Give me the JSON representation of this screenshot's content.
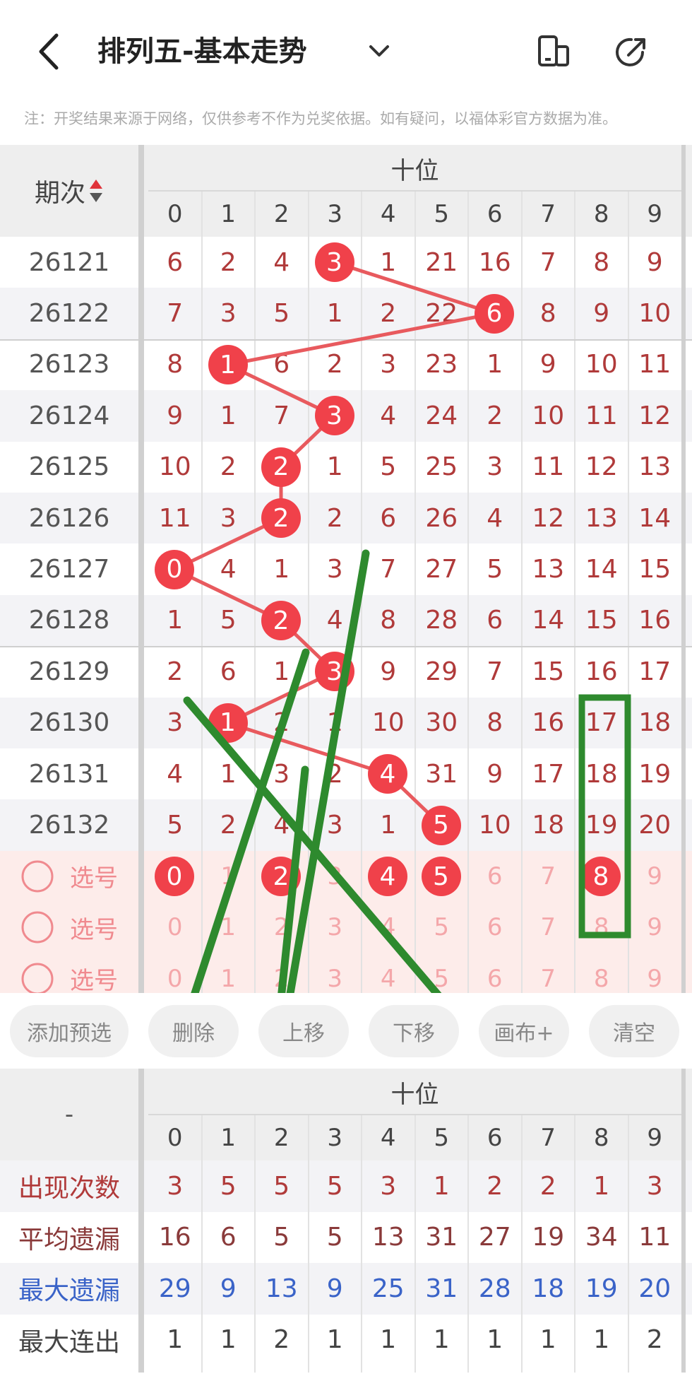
{
  "header": {
    "title": "排列五-基本走势",
    "notice": "注：开奖结果来源于网络，仅供参考不作为兑奖依据。如有疑问，以福体彩官方数据为准。"
  },
  "table": {
    "period_label": "期次",
    "group_label": "十位",
    "digits": [
      "0",
      "1",
      "2",
      "3",
      "4",
      "5",
      "6",
      "7",
      "8",
      "9"
    ],
    "rows": [
      {
        "period": "26121",
        "values": [
          6,
          2,
          4,
          3,
          1,
          21,
          16,
          7,
          8,
          9
        ],
        "hit": 3
      },
      {
        "period": "26122",
        "values": [
          7,
          3,
          5,
          1,
          2,
          22,
          6,
          8,
          9,
          10
        ],
        "hit": 6
      },
      {
        "period": "26123",
        "values": [
          8,
          1,
          6,
          2,
          3,
          23,
          1,
          9,
          10,
          11
        ],
        "hit": 1
      },
      {
        "period": "26124",
        "values": [
          9,
          1,
          7,
          3,
          4,
          24,
          2,
          10,
          11,
          12
        ],
        "hit": 3
      },
      {
        "period": "26125",
        "values": [
          10,
          2,
          2,
          1,
          5,
          25,
          3,
          11,
          12,
          13
        ],
        "hit": 2
      },
      {
        "period": "26126",
        "values": [
          11,
          3,
          2,
          2,
          6,
          26,
          4,
          12,
          13,
          14
        ],
        "hit": 2
      },
      {
        "period": "26127",
        "values": [
          0,
          4,
          1,
          3,
          7,
          27,
          5,
          13,
          14,
          15
        ],
        "hit": 0
      },
      {
        "period": "26128",
        "values": [
          1,
          5,
          2,
          4,
          8,
          28,
          6,
          14,
          15,
          16
        ],
        "hit": 2
      },
      {
        "period": "26129",
        "values": [
          2,
          6,
          1,
          3,
          9,
          29,
          7,
          15,
          16,
          17
        ],
        "hit": 3
      },
      {
        "period": "26130",
        "values": [
          3,
          1,
          2,
          1,
          10,
          30,
          8,
          16,
          17,
          18
        ],
        "hit": 1
      },
      {
        "period": "26131",
        "values": [
          4,
          1,
          3,
          2,
          4,
          31,
          9,
          17,
          18,
          19
        ],
        "hit": 4
      },
      {
        "period": "26132",
        "values": [
          5,
          2,
          4,
          3,
          1,
          5,
          10,
          18,
          19,
          20
        ],
        "hit": 5
      }
    ],
    "pick_label": "选号",
    "pick_rows": [
      {
        "selected": [
          0,
          2,
          4,
          5,
          8
        ]
      },
      {
        "selected": []
      },
      {
        "selected": []
      }
    ]
  },
  "buttons": {
    "add_preselect": "添加预选",
    "delete": "删除",
    "move_up": "上移",
    "move_down": "下移",
    "canvas": "画布+",
    "clear": "清空"
  },
  "stats": {
    "corner_label": "-",
    "group_label": "十位",
    "rows": [
      {
        "label": "出现次数",
        "values": [
          3,
          5,
          5,
          5,
          3,
          1,
          2,
          2,
          1,
          3
        ],
        "color": "#b03a3a"
      },
      {
        "label": "平均遗漏",
        "values": [
          16,
          6,
          5,
          5,
          13,
          31,
          27,
          19,
          34,
          11
        ],
        "color": "#8a3a3a"
      },
      {
        "label": "最大遗漏",
        "values": [
          29,
          9,
          13,
          9,
          25,
          31,
          28,
          18,
          19,
          20
        ],
        "color": "#3a63c8"
      },
      {
        "label": "最大连出",
        "values": [
          1,
          1,
          2,
          1,
          1,
          1,
          1,
          1,
          1,
          2
        ],
        "color": "#444444"
      }
    ]
  },
  "colors": {
    "ball": "#f0414a",
    "trend_line": "#e85a5e",
    "annotation": "#2e8a2e",
    "miss_number": "#b03a3a"
  },
  "icons": [
    "back-arrow-icon",
    "chevron-down-icon",
    "device-icon",
    "share-icon",
    "sort-arrows-icon",
    "radio-circle-icon"
  ]
}
